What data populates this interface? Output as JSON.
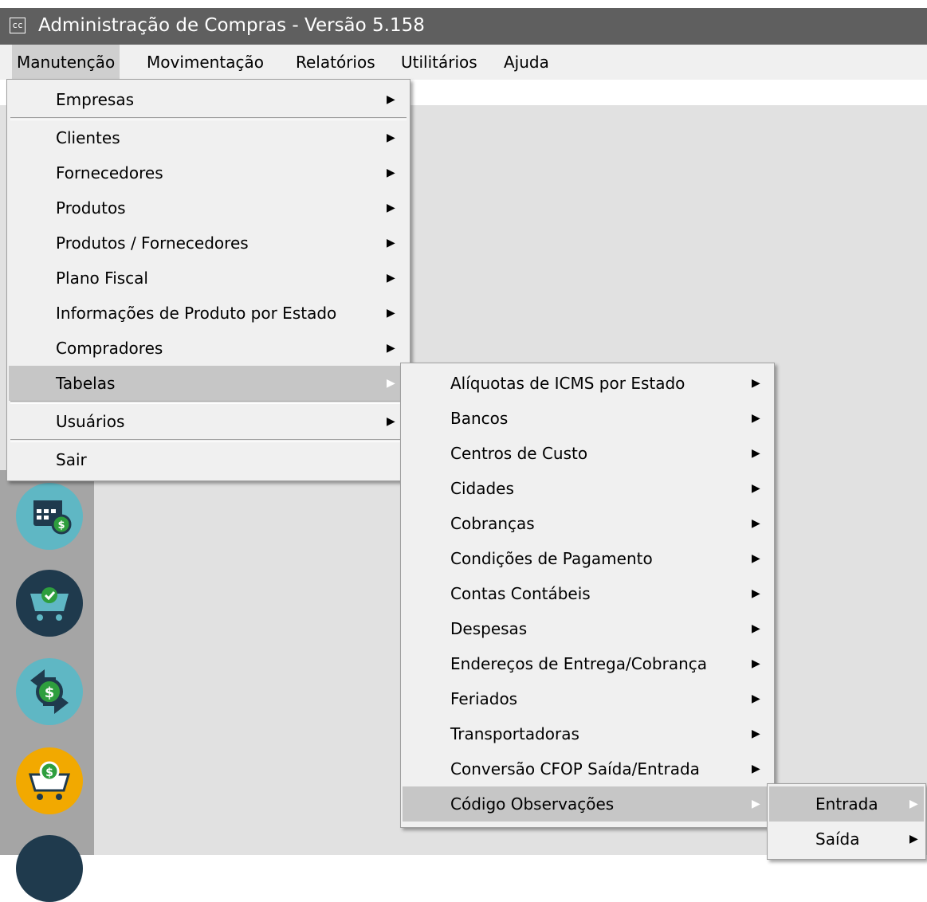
{
  "window": {
    "icon_text": "cc",
    "title": "Administração de Compras - Versão 5.158"
  },
  "menubar": [
    "Manutenção",
    "Movimentação",
    "Relatórios",
    "Utilitários",
    "Ajuda"
  ],
  "menu_manutencao": [
    "Empresas",
    "Clientes",
    "Fornecedores",
    "Produtos",
    "Produtos / Fornecedores",
    "Plano Fiscal",
    "Informações de Produto por Estado",
    "Compradores",
    "Tabelas",
    "Usuários",
    "Sair"
  ],
  "menu_tabelas": [
    "Alíquotas de ICMS por Estado",
    "Bancos",
    "Centros de Custo",
    "Cidades",
    "Cobranças",
    "Condições de Pagamento",
    "Contas Contábeis",
    "Despesas",
    "Endereços de Entrega/Cobrança",
    "Feriados",
    "Transportadoras",
    "Conversão CFOP Saída/Entrada",
    "Código Observações"
  ],
  "menu_codigo_observacoes": [
    "Entrada",
    "Saída"
  ],
  "icons": [
    "calendar-money-icon",
    "cart-check-icon",
    "money-exchange-icon",
    "cart-money-icon"
  ],
  "colors": {
    "titlebar": "#5f5f5f",
    "menu_bg": "#f0f0f0",
    "highlight": "#c6c6c6",
    "sidebar": "#a5a5a5",
    "icon_teal": "#5fb7c4",
    "icon_navy": "#1f3a4d",
    "icon_yellow": "#f2a900",
    "icon_green": "#2e9e3e"
  }
}
